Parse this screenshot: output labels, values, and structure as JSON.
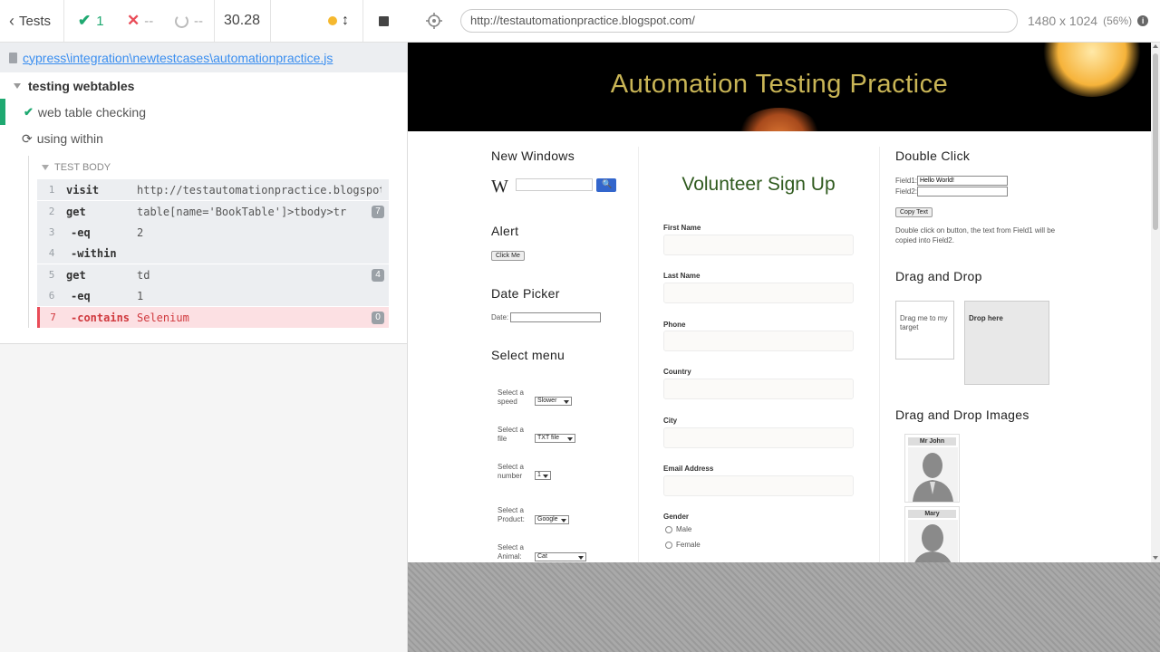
{
  "reporter": {
    "tests_label": "Tests",
    "passed_count": "1",
    "failed_count": "--",
    "pending_count": "--",
    "duration": "30.28",
    "spec_path": "cypress\\integration\\newtestcases\\automationpractice.js",
    "suite_title": "testing webtables",
    "tests": [
      {
        "title": "web table checking",
        "state": "passed"
      },
      {
        "title": "using within",
        "state": "running"
      }
    ],
    "test_body_label": "TEST BODY",
    "commands": [
      {
        "num": "1",
        "name": "visit",
        "msg": "http://testautomationpractice.blogspot.c...",
        "badge": ""
      },
      {
        "num": "2",
        "name": "get",
        "msg": "table[name='BookTable']>tbody>tr",
        "badge": "7"
      },
      {
        "num": "3",
        "name": "-eq",
        "msg": "2",
        "badge": ""
      },
      {
        "num": "4",
        "name": "-within",
        "msg": "",
        "badge": ""
      },
      {
        "num": "5",
        "name": "get",
        "msg": "td",
        "badge": "4"
      },
      {
        "num": "6",
        "name": "-eq",
        "msg": "1",
        "badge": ""
      },
      {
        "num": "7",
        "name": "-contains",
        "msg": "Selenium",
        "badge": "0"
      }
    ]
  },
  "aut": {
    "url": "http://testautomationpractice.blogspot.com/",
    "viewport_size": "1480 x 1024",
    "viewport_scale": "(56%)"
  },
  "site": {
    "title": "Automation Testing Practice",
    "new_windows": "New Windows",
    "alert": "Alert",
    "click_me": "Click Me",
    "date_picker": "Date Picker",
    "date_label": "Date:",
    "select_menu": "Select menu",
    "selects": [
      {
        "label1": "Select a",
        "label2": "speed",
        "value": "Slower"
      },
      {
        "label1": "Select a",
        "label2": "file",
        "value": "TXT file"
      },
      {
        "label1": "Select a",
        "label2": "number",
        "value": "1"
      },
      {
        "label1": "Select a",
        "label2": "Product:",
        "value": "Google"
      },
      {
        "label1": "Select a",
        "label2": "Animal:",
        "value": "Cat"
      }
    ],
    "volunteer_title": "Volunteer Sign Up",
    "fields": [
      "First Name",
      "Last Name",
      "Phone",
      "Country",
      "City",
      "Email Address"
    ],
    "gender": "Gender",
    "male": "Male",
    "female": "Female",
    "double_click": "Double Click",
    "field1": "Field1:",
    "field1_value": "Hello World!",
    "field2": "Field2:",
    "copy_text": "Copy Text",
    "dbl_desc_1": "Double click on button, the text from Field1 will be",
    "dbl_desc_2": "copied into Field2.",
    "drag_drop": "Drag and Drop",
    "drag_me_1": "Drag me to my",
    "drag_me_2": "target",
    "drop_here": "Drop here",
    "drag_images": "Drag and Drop Images",
    "mr_john": "Mr John",
    "mary": "Mary"
  },
  "colors": {
    "passed": "#1fa971",
    "failed": "#e94c58",
    "link": "#3a8ef0",
    "banner_title": "#c9b556",
    "volunteer": "#2f5a1e"
  }
}
